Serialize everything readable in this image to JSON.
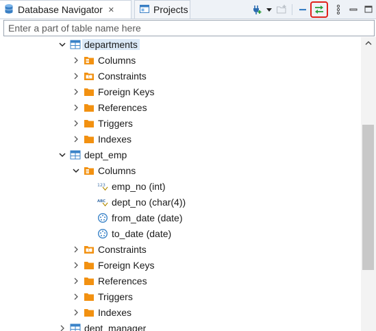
{
  "tabs": [
    {
      "label": "Database Navigator",
      "active": true,
      "icon": "database-icon"
    },
    {
      "label": "Projects",
      "active": false,
      "icon": "projects-icon"
    }
  ],
  "toolbar": {
    "items": [
      "new-connection-icon",
      "dropdown-arrow-icon",
      "new-folder-icon",
      "collapse-all-icon",
      "link-with-editor-icon",
      "view-menu-icon",
      "minimize-icon",
      "maximize-icon"
    ],
    "highlighted": "link-with-editor-icon",
    "highlight_color": "#e0201a"
  },
  "filter": {
    "placeholder": "Enter a part of table name here",
    "value": ""
  },
  "tree": [
    {
      "label": "departments",
      "icon": "table-icon",
      "level": 0,
      "expanded": true,
      "selected": true
    },
    {
      "label": "Columns",
      "icon": "columns-folder-icon",
      "level": 1,
      "expanded": false
    },
    {
      "label": "Constraints",
      "icon": "constraints-folder-icon",
      "level": 1,
      "expanded": false
    },
    {
      "label": "Foreign Keys",
      "icon": "folder-icon",
      "level": 1,
      "expanded": false
    },
    {
      "label": "References",
      "icon": "folder-icon",
      "level": 1,
      "expanded": false
    },
    {
      "label": "Triggers",
      "icon": "folder-icon",
      "level": 1,
      "expanded": false
    },
    {
      "label": "Indexes",
      "icon": "folder-icon",
      "level": 1,
      "expanded": false
    },
    {
      "label": "dept_emp",
      "icon": "table-icon",
      "level": 0,
      "expanded": true
    },
    {
      "label": "Columns",
      "icon": "columns-folder-icon",
      "level": 1,
      "expanded": true
    },
    {
      "label": "emp_no (int)",
      "icon": "numeric-column-icon",
      "level": 2,
      "leaf": true
    },
    {
      "label": "dept_no (char(4))",
      "icon": "string-column-icon",
      "level": 2,
      "leaf": true
    },
    {
      "label": "from_date (date)",
      "icon": "date-column-icon",
      "level": 2,
      "leaf": true
    },
    {
      "label": "to_date (date)",
      "icon": "date-column-icon",
      "level": 2,
      "leaf": true
    },
    {
      "label": "Constraints",
      "icon": "constraints-folder-icon",
      "level": 1,
      "expanded": false
    },
    {
      "label": "Foreign Keys",
      "icon": "folder-icon",
      "level": 1,
      "expanded": false
    },
    {
      "label": "References",
      "icon": "folder-icon",
      "level": 1,
      "expanded": false
    },
    {
      "label": "Triggers",
      "icon": "folder-icon",
      "level": 1,
      "expanded": false
    },
    {
      "label": "Indexes",
      "icon": "folder-icon",
      "level": 1,
      "expanded": false
    },
    {
      "label": "dept_manager",
      "icon": "table-icon",
      "level": 0,
      "expanded": false
    }
  ],
  "colors": {
    "folder": "#f29111",
    "table": "#3a83c8",
    "selection": "#dbe9f7",
    "scroll_thumb": "#c8c8c8"
  }
}
